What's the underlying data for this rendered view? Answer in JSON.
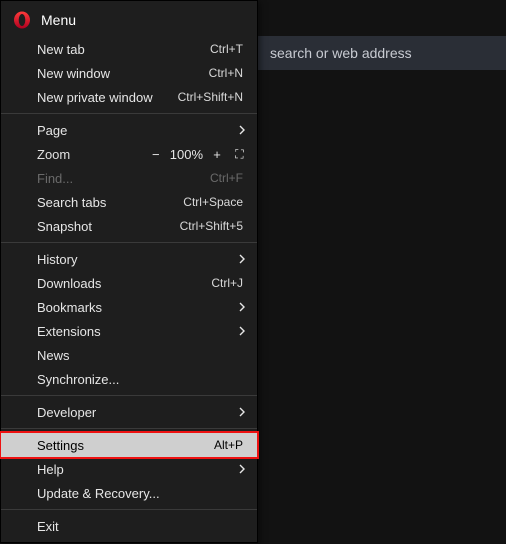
{
  "backdrop": {
    "search_placeholder_fragment": "search or web address"
  },
  "menu": {
    "title": "Menu",
    "zoom": {
      "label": "Zoom",
      "value": "100%"
    },
    "items": {
      "new_tab": {
        "label": "New tab",
        "accel": "Ctrl+T"
      },
      "new_window": {
        "label": "New window",
        "accel": "Ctrl+N"
      },
      "new_private": {
        "label": "New private window",
        "accel": "Ctrl+Shift+N"
      },
      "page": {
        "label": "Page"
      },
      "find": {
        "label": "Find...",
        "accel": "Ctrl+F"
      },
      "search_tabs": {
        "label": "Search tabs",
        "accel": "Ctrl+Space"
      },
      "snapshot": {
        "label": "Snapshot",
        "accel": "Ctrl+Shift+5"
      },
      "history": {
        "label": "History"
      },
      "downloads": {
        "label": "Downloads",
        "accel": "Ctrl+J"
      },
      "bookmarks": {
        "label": "Bookmarks"
      },
      "extensions": {
        "label": "Extensions"
      },
      "news": {
        "label": "News"
      },
      "synchronize": {
        "label": "Synchronize..."
      },
      "developer": {
        "label": "Developer"
      },
      "settings": {
        "label": "Settings",
        "accel": "Alt+P"
      },
      "help": {
        "label": "Help"
      },
      "update": {
        "label": "Update & Recovery..."
      },
      "exit": {
        "label": "Exit"
      }
    }
  }
}
